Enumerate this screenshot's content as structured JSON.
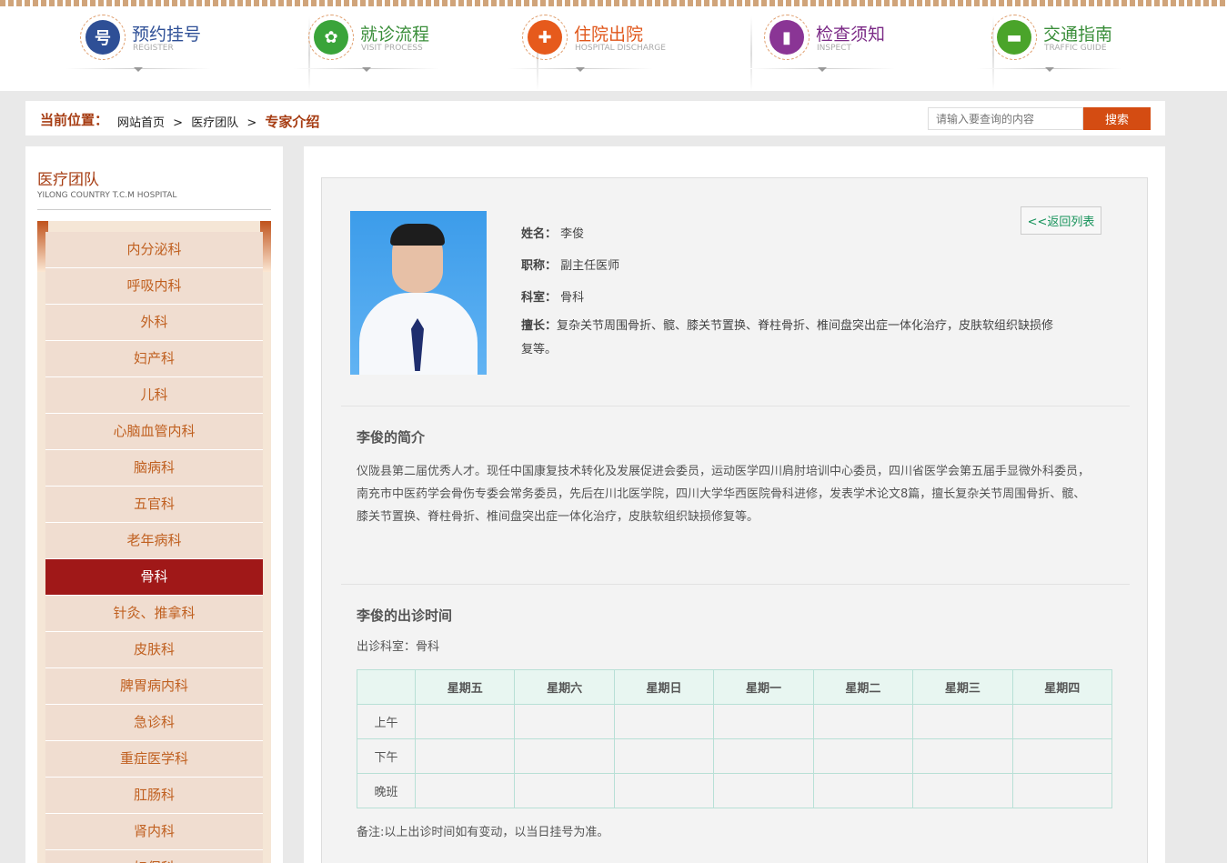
{
  "topnav": [
    {
      "title": "预约挂号",
      "sub": "REGISTER",
      "color": "#2e4f96",
      "icon_color": "#2e4f96",
      "icon": "register-icon",
      "glyph": "号"
    },
    {
      "title": "就诊流程",
      "sub": "VISIT PROCESS",
      "color": "#3a8e3a",
      "icon_color": "#3aa43a",
      "icon": "leaf-icon",
      "glyph": "✿"
    },
    {
      "title": "住院出院",
      "sub": "HOSPITAL DISCHARGE",
      "color": "#e0571b",
      "icon_color": "#e65a1c",
      "icon": "medkit-icon",
      "glyph": "✚"
    },
    {
      "title": "检查须知",
      "sub": "INSPECT",
      "color": "#7b2a86",
      "icon_color": "#8a3595",
      "icon": "vial-icon",
      "glyph": "▮"
    },
    {
      "title": "交通指南",
      "sub": "TRAFFIC GUIDE",
      "color": "#3a8e3a",
      "icon_color": "#4aa42a",
      "icon": "car-icon",
      "glyph": "▬"
    }
  ],
  "breadcrumb": {
    "label": "当前位置：",
    "home": "网站首页",
    "sep": ">",
    "team": "医疗团队",
    "current": "专家介绍"
  },
  "search": {
    "placeholder": "请输入要查询的内容",
    "button": "搜索"
  },
  "sidebar": {
    "title": "医疗团队",
    "subtitle": "YILONG COUNTRY T.C.M HOSPITAL",
    "items": [
      "内分泌科",
      "呼吸内科",
      "外科",
      "妇产科",
      "儿科",
      "心脑血管内科",
      "脑病科",
      "五官科",
      "老年病科",
      "骨科",
      "针灸、推拿科",
      "皮肤科",
      "脾胃病内科",
      "急诊科",
      "重症医学科",
      "肛肠科",
      "肾内科",
      "妇保科"
    ],
    "active_index": 9
  },
  "doctor": {
    "name_label": "姓名：",
    "name": "李俊",
    "title_label": "职称：",
    "title": "副主任医师",
    "dept_label": "科室：",
    "dept": "骨科",
    "skill_label": "擅长：",
    "skill_line1": "复杂关节周围骨折、髋、膝关节置换、脊柱骨折、椎间盘突出症一体化治疗，皮肤软组织缺损修",
    "skill_line2": "复等。",
    "back": "<<返回列表"
  },
  "intro": {
    "title": "李俊的简介",
    "text": "仪陇县第二届优秀人才。现任中国康复技术转化及发展促进会委员，运动医学四川肩肘培训中心委员，四川省医学会第五届手显微外科委员，南充市中医药学会骨伤专委会常务委员，先后在川北医学院，四川大学华西医院骨科进修，发表学术论文8篇，擅长复杂关节周围骨折、髋、膝关节置换、脊柱骨折、椎间盘突出症一体化治疗，皮肤软组织缺损修复等。"
  },
  "schedule": {
    "title": "李俊的出诊时间",
    "dept_line": "出诊科室：骨科",
    "days": [
      "星期五",
      "星期六",
      "星期日",
      "星期一",
      "星期二",
      "星期三",
      "星期四"
    ],
    "rows": [
      "上午",
      "下午",
      "晚班"
    ],
    "note": "备注:以上出诊时间如有变动，以当日挂号为准。"
  }
}
